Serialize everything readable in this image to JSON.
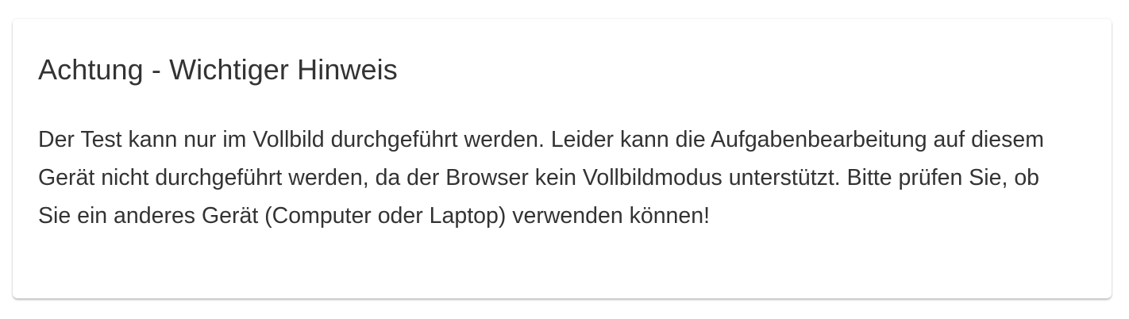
{
  "notice": {
    "title": "Achtung - Wichtiger Hinweis",
    "body": "Der Test kann nur im Vollbild durchgeführt werden. Leider kann die Aufgabenbearbeitung auf diesem Gerät nicht durchgeführt werden, da der Browser kein Vollbildmodus unterstützt. Bitte prüfen Sie, ob Sie ein anderes Gerät (Computer oder Laptop) verwenden können!"
  },
  "colors": {
    "text": "#333333",
    "card_background": "#ffffff",
    "page_background": "#ffffff"
  }
}
